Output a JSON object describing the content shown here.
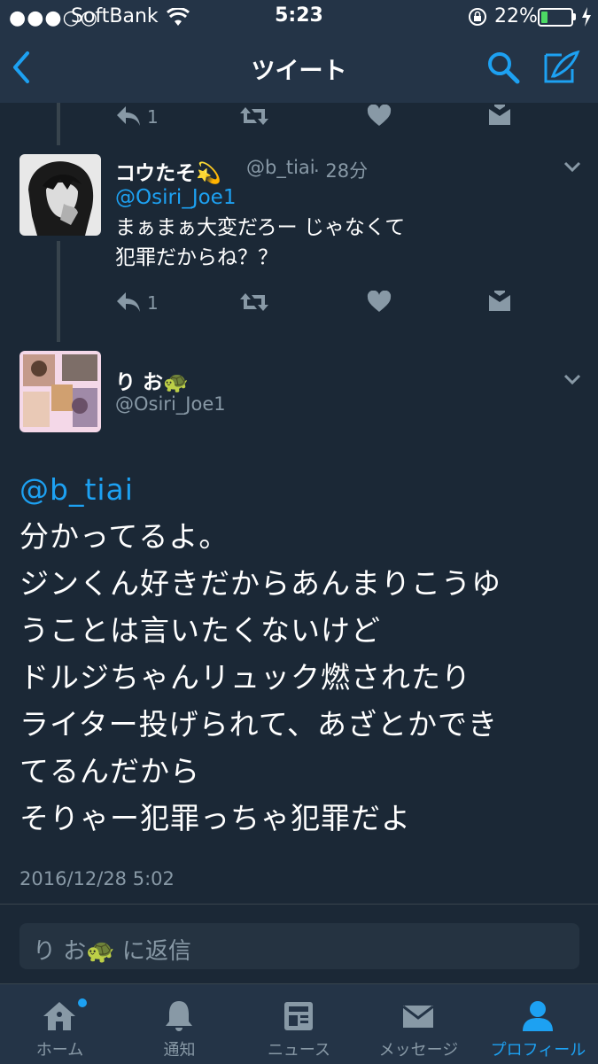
{
  "status_bar": {
    "signal": "●●●○○",
    "carrier": "SoftBank",
    "time": "5:23",
    "battery_percent": "22%",
    "battery_level": 0.22
  },
  "nav": {
    "title": "ツイート",
    "icons": [
      "back-icon",
      "search-icon",
      "compose-icon"
    ]
  },
  "top_tweet_actions": {
    "reply_count": "1"
  },
  "reply_tweet": {
    "name": "コウたそ💫",
    "handle": "@b_tiai",
    "time": "· 28分",
    "mention": "@Osiri_Joe1",
    "lines": [
      "まぁまぁ大変だろー じゃなくて",
      "犯罪だからね？？"
    ],
    "reply_count": "1"
  },
  "main_tweet": {
    "name": "り お🐢",
    "handle": "@Osiri_Joe1",
    "mention": "@b_tiai",
    "lines": [
      "分かってるよ。",
      "ジンくん好きだからあんまりこうゆ",
      "うことは言いたくないけど",
      "ドルジちゃんリュック燃されたり",
      "ライター投げられて、あざとかでき",
      "てるんだから",
      "そりゃー犯罪っちゃ犯罪だよ"
    ],
    "timestamp": "2016/12/28 5:02"
  },
  "reply_box": {
    "placeholder": "り お🐢  に返信"
  },
  "tabs": [
    {
      "label": "ホーム",
      "icon": "home-icon"
    },
    {
      "label": "通知",
      "icon": "bell-icon"
    },
    {
      "label": "ニュース",
      "icon": "news-icon"
    },
    {
      "label": "メッセージ",
      "icon": "mail-icon"
    },
    {
      "label": "プロフィール",
      "icon": "profile-icon"
    }
  ],
  "colors": {
    "accent": "#1da1f2",
    "background": "#1b2836",
    "bar": "#243447",
    "muted": "#8899a6"
  }
}
